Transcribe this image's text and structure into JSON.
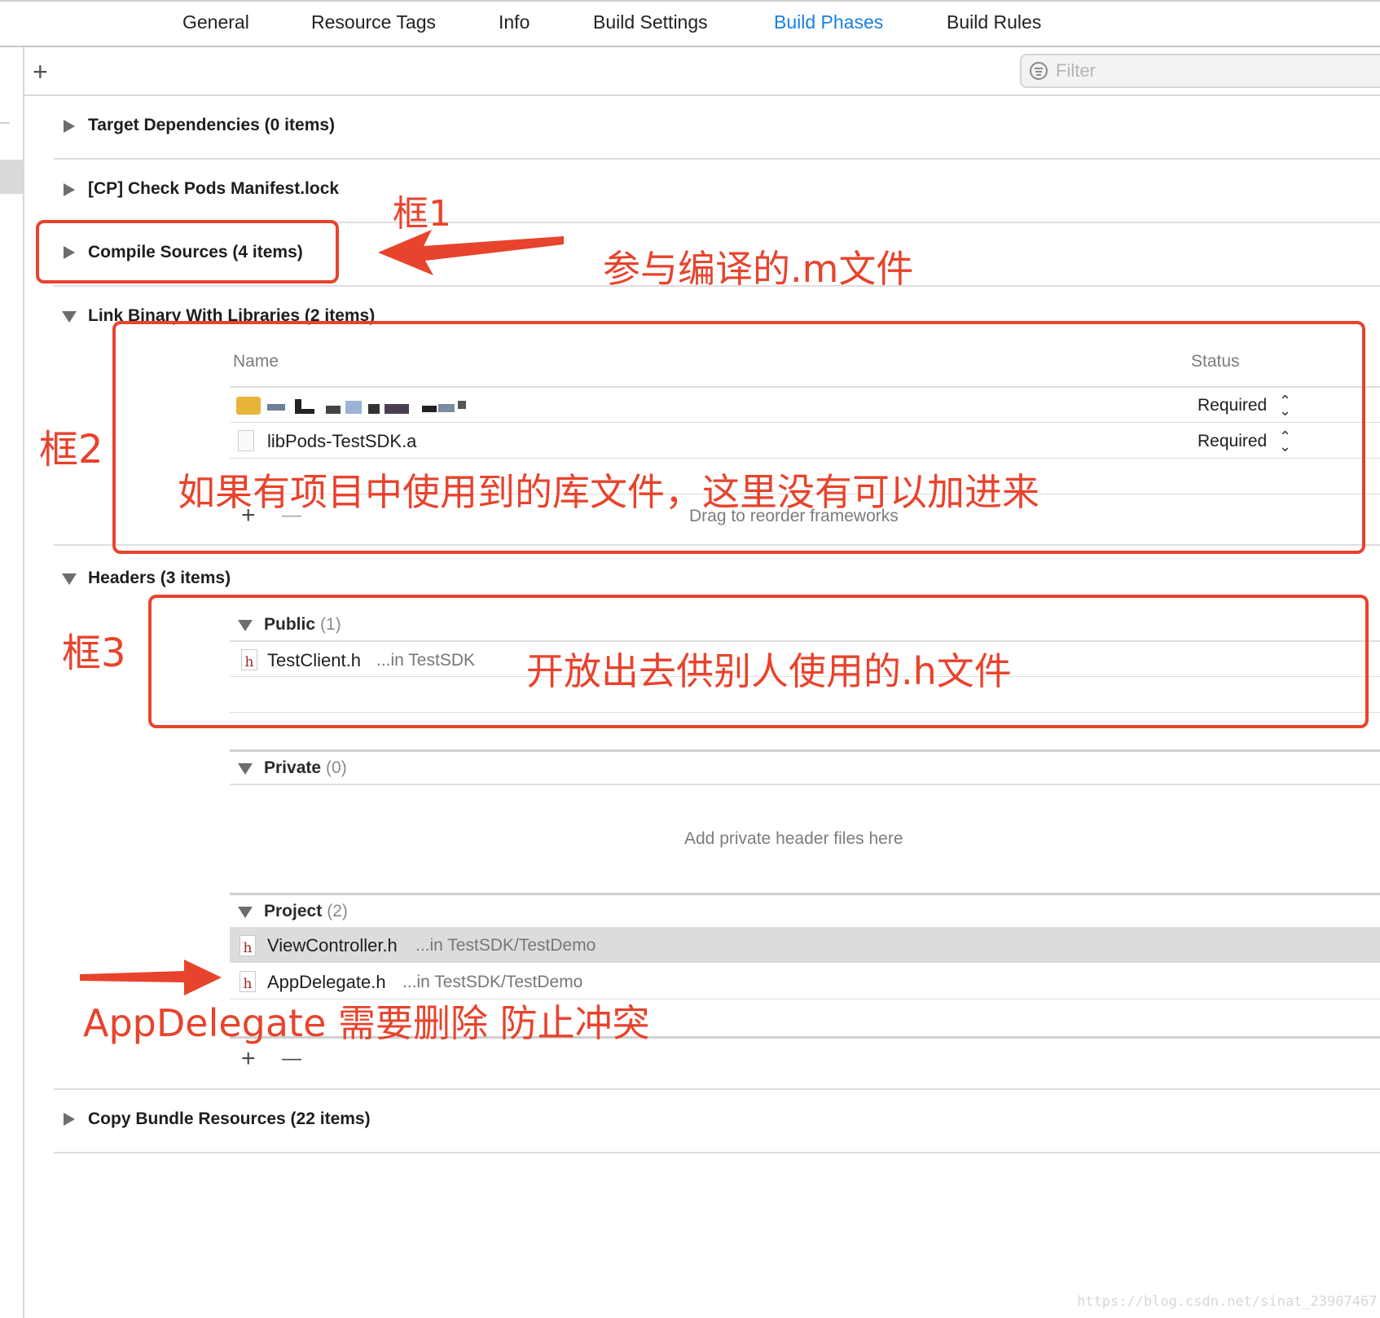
{
  "tabs": [
    {
      "label": "General",
      "active": false
    },
    {
      "label": "Resource Tags",
      "active": false
    },
    {
      "label": "Info",
      "active": false
    },
    {
      "label": "Build Settings",
      "active": false
    },
    {
      "label": "Build Phases",
      "active": true
    },
    {
      "label": "Build Rules",
      "active": false
    }
  ],
  "toolbar": {
    "add_symbol": "+",
    "filter_placeholder": "Filter"
  },
  "phases": {
    "target_dependencies": "Target Dependencies (0 items)",
    "check_pods": "[CP] Check Pods Manifest.lock",
    "compile_sources": "Compile Sources (4 items)",
    "link_binary": "Link Binary With Libraries (2 items)",
    "headers": "Headers (3 items)",
    "copy_bundle": "Copy Bundle Resources (22 items)"
  },
  "link_table": {
    "col_name": "Name",
    "col_status": "Status",
    "rows": [
      {
        "name": "",
        "status": "Required"
      },
      {
        "name": "libPods-TestSDK.a",
        "status": "Required"
      }
    ],
    "hint": "Drag to reorder frameworks",
    "add_symbol": "+",
    "remove_symbol": "—"
  },
  "headers_section": {
    "public": {
      "label": "Public",
      "count": "(1)",
      "files": [
        {
          "name": "TestClient.h",
          "path": "...in TestSDK"
        }
      ]
    },
    "private": {
      "label": "Private",
      "count": "(0)",
      "empty_hint": "Add private header files here"
    },
    "project": {
      "label": "Project",
      "count": "(2)",
      "files": [
        {
          "name": "ViewController.h",
          "path": "...in TestSDK/TestDemo"
        },
        {
          "name": "AppDelegate.h",
          "path": "...in TestSDK/TestDemo"
        }
      ]
    },
    "add_symbol": "+",
    "remove_symbol": "—",
    "file_icon_letter": "h"
  },
  "annotations": {
    "box1_label": "框1",
    "box1_text": "参与编译的.m文件",
    "box2_label": "框2",
    "box2_text": "如果有项目中使用到的库文件，这里没有可以加进来",
    "box3_label": "框3",
    "box3_text": "开放出去供别人使用的.h文件",
    "appdelegate_text": "AppDelegate 需要删除 防止冲突",
    "color": "#e8432c"
  },
  "watermark": "https://blog.csdn.net/sinat_23907467"
}
